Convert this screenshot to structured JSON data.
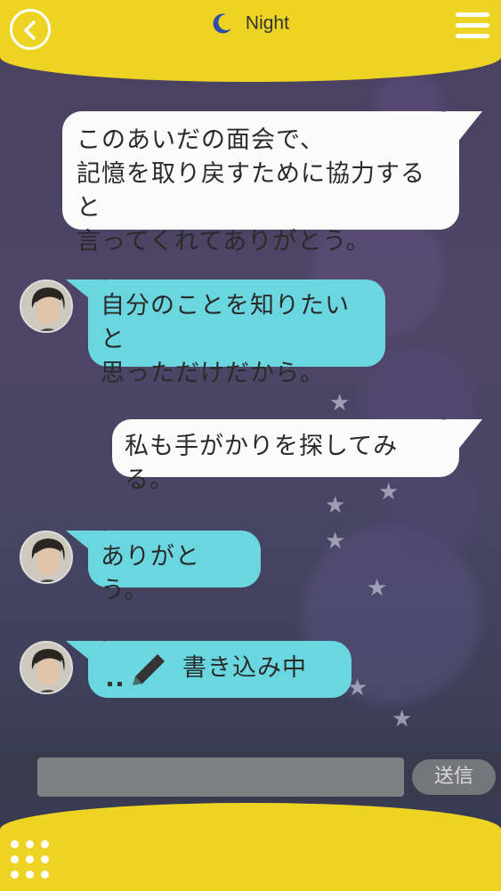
{
  "header": {
    "title": "Night",
    "back_icon": "chevron-left-icon",
    "moon_icon": "crescent-moon-icon",
    "menu_icon": "hamburger-menu-icon"
  },
  "messages": [
    {
      "from": "me",
      "lines": [
        "このあいだの面会で、",
        "記憶を取り戻すために協力すると",
        "言ってくれてありがとう。"
      ]
    },
    {
      "from": "other",
      "lines": [
        "自分のことを知りたいと",
        "思っただけだから。"
      ]
    },
    {
      "from": "me",
      "lines": [
        "私も手がかりを探してみる。"
      ]
    },
    {
      "from": "other",
      "lines": [
        "ありがとう。"
      ]
    },
    {
      "from": "other",
      "typing": true,
      "lines": [
        "書き込み中"
      ]
    }
  ],
  "input": {
    "placeholder": "",
    "send_label": "送信"
  },
  "footer": {
    "grid_icon": "dots-grid-icon"
  },
  "colors": {
    "header": "#ecd324",
    "bubble_me": "#fbfbfb",
    "bubble_other": "#6ad7e0"
  }
}
